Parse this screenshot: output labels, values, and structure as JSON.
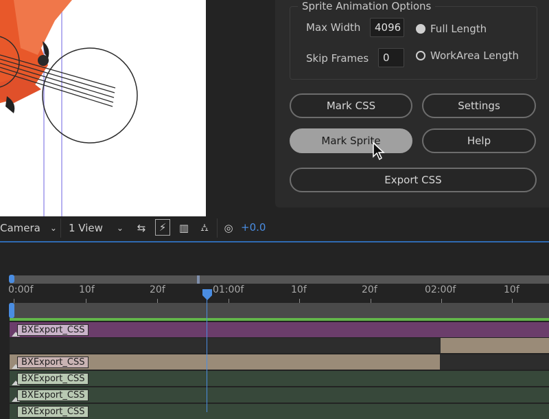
{
  "panel": {
    "group_title": "Sprite Animation Options",
    "max_width_label": "Max Width",
    "max_width_value": "4096",
    "skip_frames_label": "Skip Frames",
    "skip_frames_value": "0",
    "radio_full_length": "Full Length",
    "radio_workarea_length": "WorkArea Length",
    "selected_radio": "Full Length",
    "buttons": {
      "mark_css": "Mark CSS",
      "settings": "Settings",
      "mark_sprite": "Mark Sprite",
      "help": "Help",
      "export_css": "Export CSS"
    }
  },
  "toolbar": {
    "camera_dropdown": "Camera",
    "view_dropdown": "1 View",
    "exposure_value": "+0.0"
  },
  "timeline": {
    "ruler_labels": [
      "0:00f",
      "10f",
      "20f",
      "01:00f",
      "10f",
      "20f",
      "02:00f",
      "10f"
    ],
    "layers": [
      {
        "name": "BXExport_CSS",
        "color": "#c9b3c9"
      },
      {
        "name": "BXExport_CSS",
        "color": "#c9b3b3"
      },
      {
        "name": "BXExport_CSS",
        "color": "#b9c9b3"
      },
      {
        "name": "BXExport_CSS",
        "color": "#b9c9b3"
      },
      {
        "name": "BXExport_CSS",
        "color": "#b9c9b3"
      }
    ]
  },
  "colors": {
    "accent_blue": "#4a8de2",
    "green_bar": "#62b64a",
    "purple_layer": "#6b3d6b",
    "tan_layer": "#9a8b78",
    "dark_green_layer": "#37483a"
  }
}
